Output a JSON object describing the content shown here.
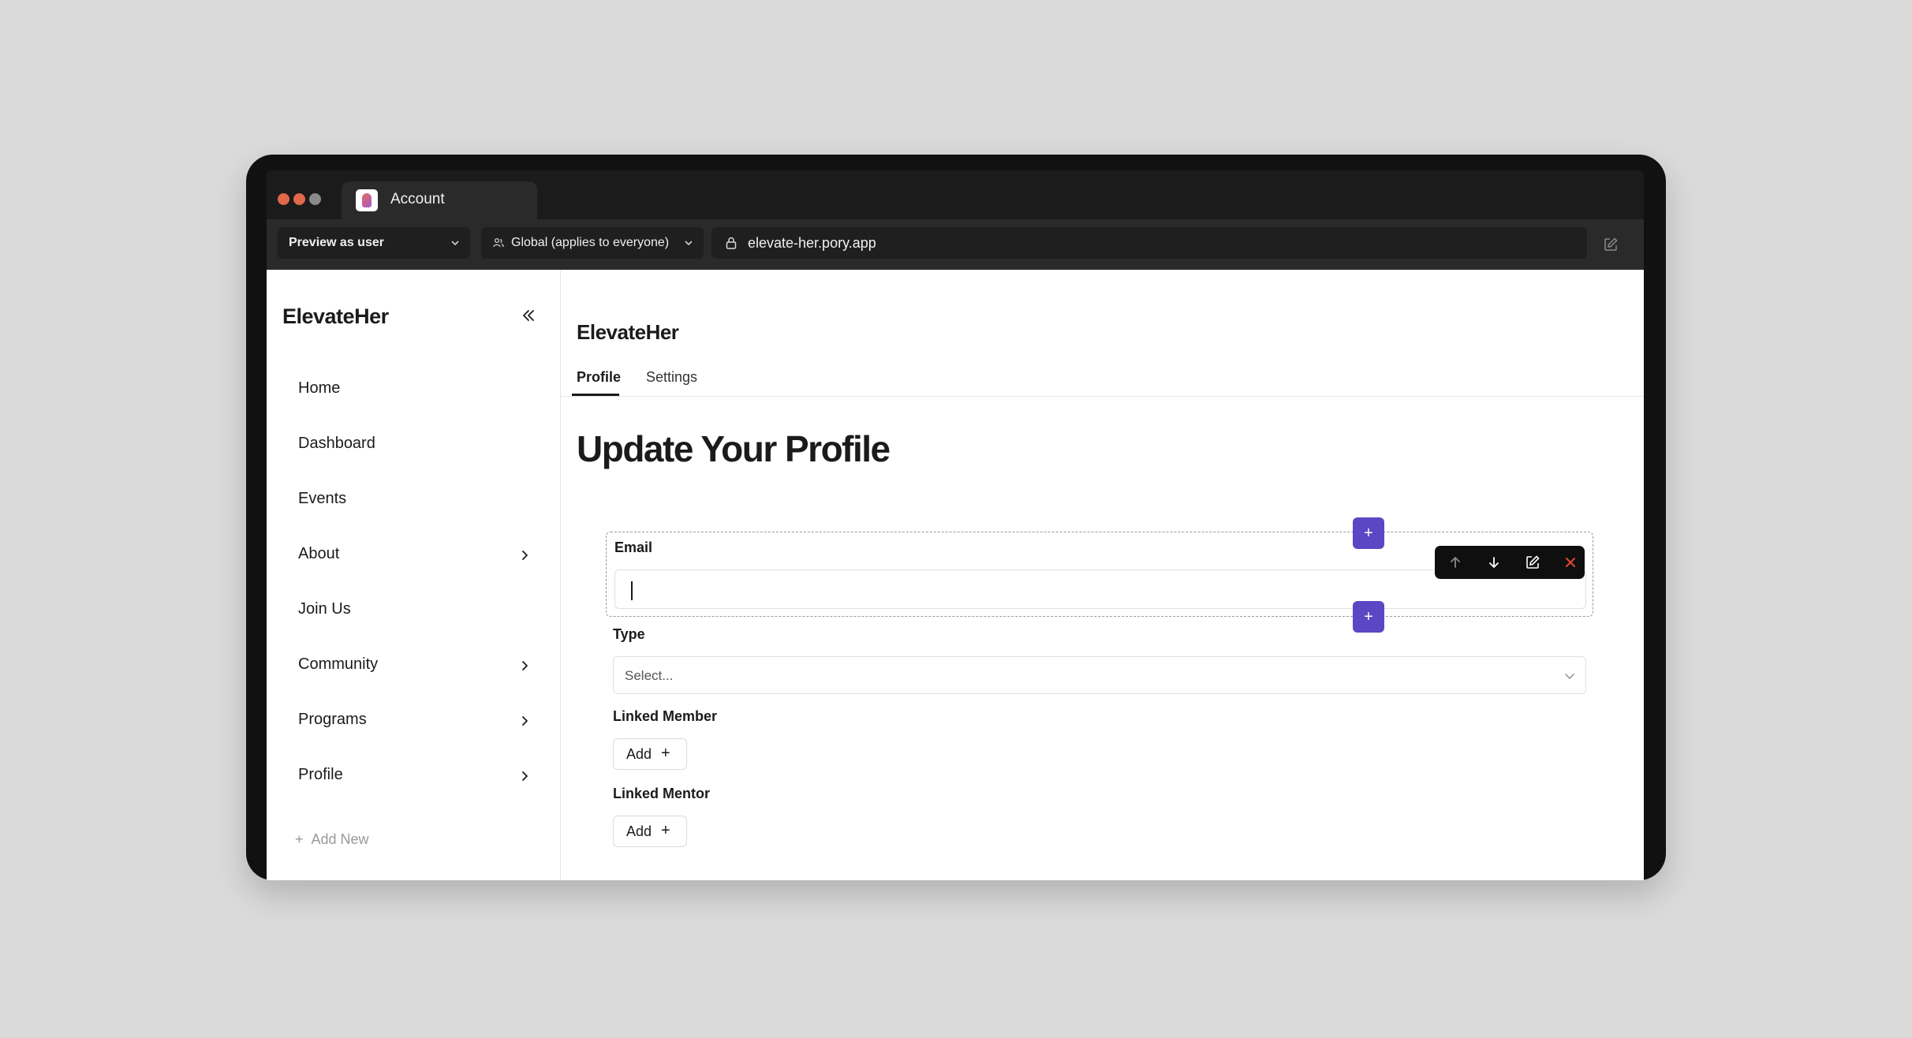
{
  "browser": {
    "tab_title": "Account",
    "traffic_lights": [
      "#e0684b",
      "#e0684b",
      "#8a8a8a"
    ]
  },
  "toolbar": {
    "preview_label": "Preview as user",
    "scope_label": "Global (applies to everyone)",
    "url": "elevate-her.pory.app"
  },
  "sidebar": {
    "brand": "ElevateHer",
    "items": [
      {
        "label": "Home",
        "has_children": false
      },
      {
        "label": "Dashboard",
        "has_children": false
      },
      {
        "label": "Events",
        "has_children": false
      },
      {
        "label": "About",
        "has_children": true
      },
      {
        "label": "Join Us",
        "has_children": false
      },
      {
        "label": "Community",
        "has_children": true
      },
      {
        "label": "Programs",
        "has_children": true
      },
      {
        "label": "Profile",
        "has_children": true
      }
    ],
    "add_new": "Add New"
  },
  "main": {
    "app_title": "ElevateHer",
    "tabs": [
      {
        "label": "Profile",
        "active": true
      },
      {
        "label": "Settings",
        "active": false
      }
    ],
    "page_title": "Update Your Profile",
    "form": {
      "email_label": "Email",
      "email_value": "",
      "type_label": "Type",
      "type_placeholder": "Select...",
      "linked_member_label": "Linked Member",
      "linked_mentor_label": "Linked Mentor",
      "add_label": "Add",
      "plus_glyph": "+"
    }
  },
  "colors": {
    "accent": "#5b47c4",
    "delete": "#e0483a"
  }
}
